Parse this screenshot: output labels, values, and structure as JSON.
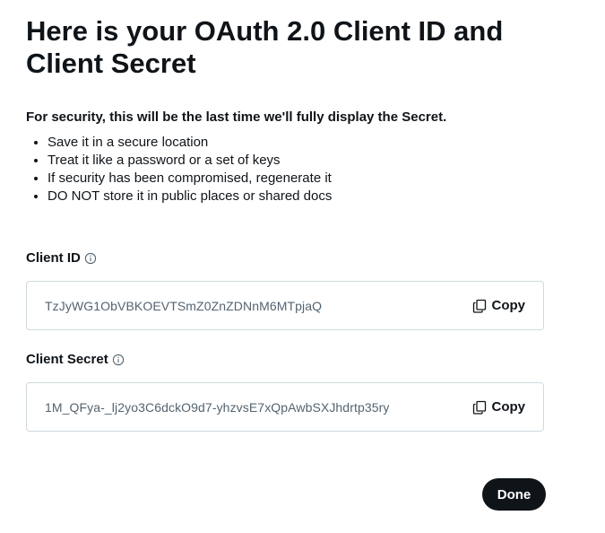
{
  "title": "Here is your OAuth 2.0 Client ID and Client Secret",
  "security_note": "For security, this will be the last time we'll fully display the Secret.",
  "tips": [
    "Save it in a secure location",
    "Treat it like a password or a set of keys",
    "If security has been compromised, regenerate it",
    "DO NOT store it in public places or shared docs"
  ],
  "client_id": {
    "label": "Client ID",
    "value": "TzJyWG1ObVBKOEVTSmZ0ZnZDNnM6MTpjaQ",
    "copy_label": "Copy",
    "info_icon": "info-icon"
  },
  "client_secret": {
    "label": "Client Secret",
    "value": "1M_QFya-_lj2yo3C6dckO9d7-yhzvsE7xQpAwbSXJhdrtp35ry",
    "copy_label": "Copy",
    "info_icon": "info-icon"
  },
  "done_label": "Done",
  "colors": {
    "text": "#0f1419",
    "muted": "#536471",
    "border": "#cfd9de",
    "button_bg": "#0f1419",
    "button_text": "#ffffff"
  }
}
